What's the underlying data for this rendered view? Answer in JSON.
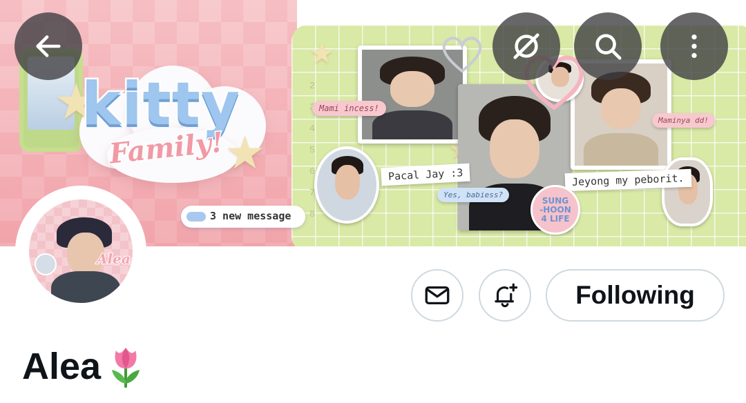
{
  "header": {
    "back_icon": "arrow-left-icon",
    "grok_icon": "grok-icon",
    "search_icon": "search-icon",
    "more_icon": "more-vertical-icon"
  },
  "banner": {
    "logo_title": "kitty",
    "logo_subtitle": "Family!",
    "message_pill": "3 new message",
    "bubbles": {
      "mami": "Mami incess!",
      "yes": "Yes, babiess?",
      "maminya": "Maminya dd!"
    },
    "captions": {
      "pacal": "Pacal Jay :3",
      "jeyong": "Jeyong my peborit."
    },
    "badge_lines": [
      "SUNG",
      "-HOON",
      "4 LIFE"
    ],
    "ruler_numbers": [
      "2",
      "3",
      "4",
      "5",
      "6",
      "7",
      "8"
    ]
  },
  "profile": {
    "avatar_tag": "Alea",
    "message_icon": "envelope-icon",
    "notify_icon": "bell-plus-icon",
    "following_label": "Following",
    "display_name": "Alea",
    "name_emoji": "tulip-emoji"
  },
  "colors": {
    "text_primary": "#0f1419",
    "button_border": "#cfd9de",
    "header_button_bg": "#3c3c40",
    "banner_pink": "#f4b3b8",
    "banner_green": "#d9e9a6"
  }
}
